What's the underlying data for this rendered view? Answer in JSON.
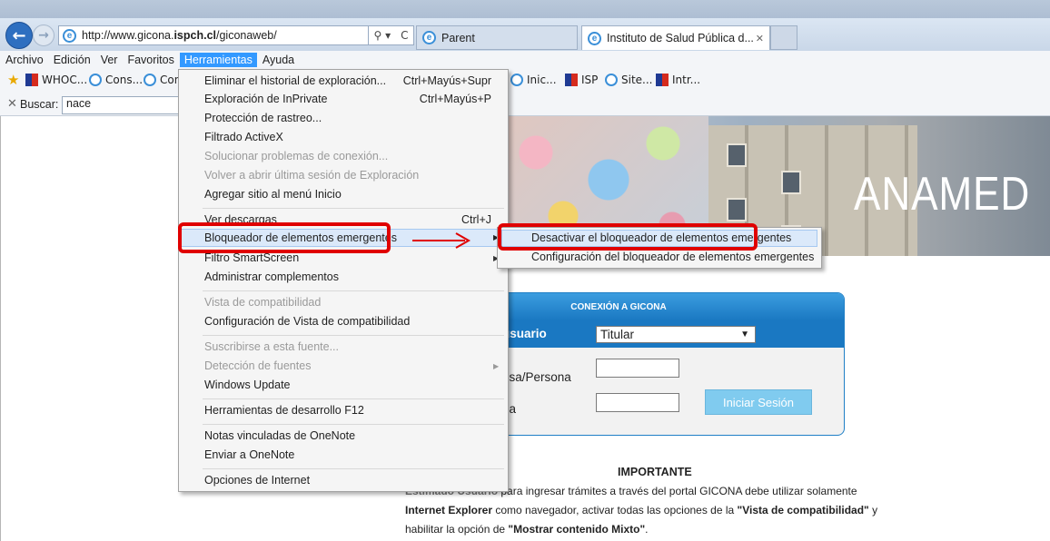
{
  "browser": {
    "address": {
      "prefix": "http://www.gicona.",
      "host_bold": "ispch.cl",
      "suffix": "/giconaweb/"
    },
    "address_controls": {
      "search": "⚲ ▾",
      "refresh": "C"
    },
    "tabs": [
      {
        "label": "Parent"
      },
      {
        "label": "Instituto de Salud Pública d..."
      }
    ],
    "menubar": [
      "Archivo",
      "Edición",
      "Ver",
      "Favoritos",
      "Herramientas",
      "Ayuda"
    ],
    "favorites": [
      "WHOC...",
      "Cons...",
      "Con",
      "Inic...",
      "ISP",
      "Site...",
      "Intr..."
    ],
    "find": {
      "label": "Buscar:",
      "value": "nace"
    }
  },
  "tools_menu": {
    "items": [
      {
        "label": "Eliminar el historial de exploración...",
        "shortcut": "Ctrl+Mayús+Supr",
        "disabled": false
      },
      {
        "label": "Exploración de InPrivate",
        "shortcut": "Ctrl+Mayús+P",
        "disabled": false
      },
      {
        "label": "Protección de rastreo...",
        "disabled": false
      },
      {
        "label": "Filtrado ActiveX",
        "disabled": false
      },
      {
        "label": "Solucionar problemas de conexión...",
        "disabled": true
      },
      {
        "label": "Volver a abrir última sesión de Exploración",
        "disabled": true
      },
      {
        "label": "Agregar sitio al menú Inicio",
        "disabled": false
      },
      {
        "label": "Ver descargas",
        "shortcut": "Ctrl+J",
        "disabled": false
      },
      {
        "label": "Bloqueador de elementos emergentes",
        "disabled": false,
        "submenu": true
      },
      {
        "label": "Filtro SmartScreen",
        "disabled": false,
        "submenu": true
      },
      {
        "label": "Administrar complementos",
        "disabled": false
      },
      {
        "label": "Vista de compatibilidad",
        "disabled": true
      },
      {
        "label": "Configuración de Vista de compatibilidad",
        "disabled": false
      },
      {
        "label": "Suscribirse a esta fuente...",
        "disabled": true
      },
      {
        "label": "Detección de fuentes",
        "disabled": true,
        "submenu": true
      },
      {
        "label": "Windows Update",
        "disabled": false
      },
      {
        "label": "Herramientas de desarrollo F12",
        "disabled": false
      },
      {
        "label": "Notas vinculadas de OneNote",
        "disabled": false
      },
      {
        "label": "Enviar a OneNote",
        "disabled": false
      },
      {
        "label": "Opciones de Internet",
        "disabled": false
      }
    ]
  },
  "popup_submenu": {
    "items": [
      {
        "label": "Desactivar el bloqueador de elementos emergentes"
      },
      {
        "label": "Configuración del bloqueador de elementos emergentes"
      }
    ]
  },
  "page": {
    "banner_text": "ANAMED",
    "login": {
      "title": "CONEXIÓN A GICONA",
      "user_label": "usuario",
      "user_select": "Titular",
      "company_label": "esa/Persona",
      "password_label": "ña",
      "login_button": "Iniciar Sesión"
    },
    "important": {
      "title": "IMPORTANTE",
      "line1_hidden": "Estimado Usuario",
      "line1": "para ingresar trámites a través del portal GICONA debe utilizar solamente",
      "line2_a": "Internet Explorer",
      "line2_b": " como navegador, activar todas las opciones de la ",
      "line2_c": "\"Vista de compatibilidad\"",
      "line2_d": " y",
      "line3_a": "habilitar la opción de ",
      "line3_b": "\"Mostrar contenido Mixto\"",
      "line3_c": "."
    }
  },
  "colors": {
    "highlight": "#e00000",
    "accent": "#3399ff",
    "login_blue": "#1a78c2"
  }
}
